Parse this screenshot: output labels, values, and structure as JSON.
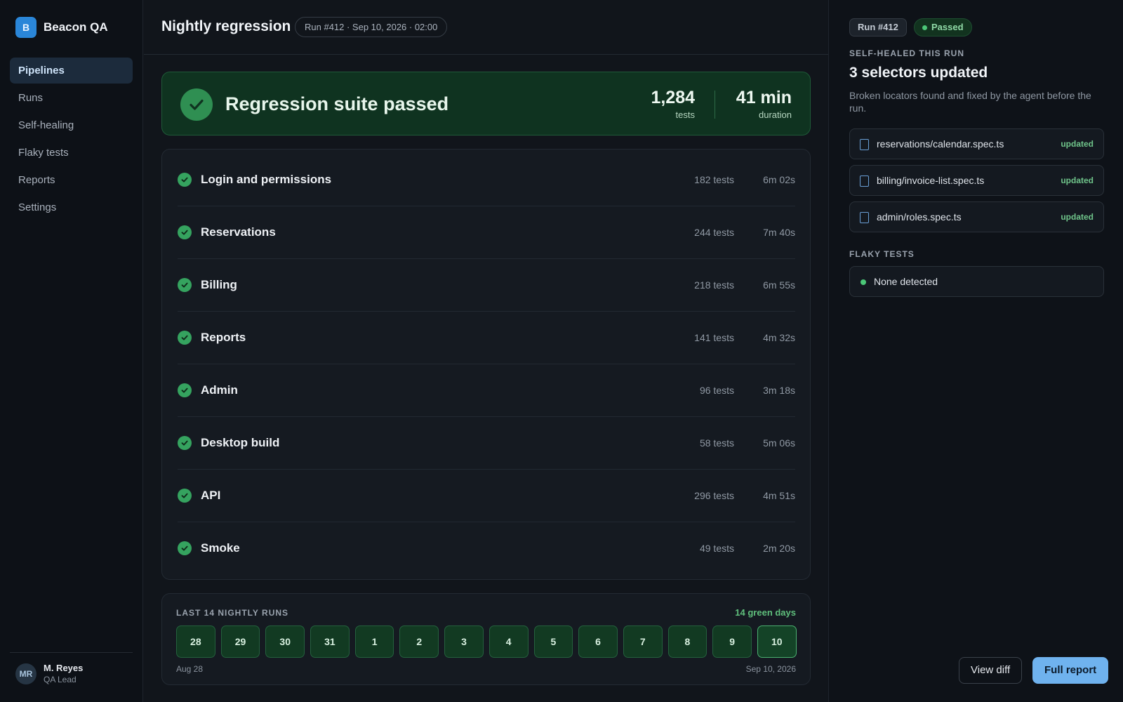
{
  "brand": {
    "logo_letter": "B",
    "name": "Beacon QA"
  },
  "sidebar": {
    "items": [
      {
        "label": "Pipelines",
        "active": true
      },
      {
        "label": "Runs",
        "active": false
      },
      {
        "label": "Self-healing",
        "active": false
      },
      {
        "label": "Flaky tests",
        "active": false
      },
      {
        "label": "Reports",
        "active": false
      },
      {
        "label": "Settings",
        "active": false
      }
    ]
  },
  "user": {
    "initials": "MR",
    "name": "M. Reyes",
    "role": "QA Lead"
  },
  "header": {
    "title": "Nightly regression",
    "run_chip": "Run #412 · Sep 10, 2026 · 02:00"
  },
  "banner": {
    "title": "Regression suite passed",
    "tests_value": "1,284",
    "tests_label": "tests",
    "duration_value": "41 min",
    "duration_label": "duration"
  },
  "suites": [
    {
      "name": "Login and permissions",
      "tests": "182 tests",
      "duration": "6m 02s"
    },
    {
      "name": "Reservations",
      "tests": "244 tests",
      "duration": "7m 40s"
    },
    {
      "name": "Billing",
      "tests": "218 tests",
      "duration": "6m 55s"
    },
    {
      "name": "Reports",
      "tests": "141 tests",
      "duration": "4m 32s"
    },
    {
      "name": "Admin",
      "tests": "96 tests",
      "duration": "3m 18s"
    },
    {
      "name": "Desktop build",
      "tests": "58 tests",
      "duration": "5m 06s"
    },
    {
      "name": "API",
      "tests": "296 tests",
      "duration": "4m 51s"
    },
    {
      "name": "Smoke",
      "tests": "49 tests",
      "duration": "2m 20s"
    }
  ],
  "history": {
    "title": "LAST 14 NIGHTLY RUNS",
    "green_days": "14 green days",
    "days": [
      "28",
      "29",
      "30",
      "31",
      "1",
      "2",
      "3",
      "4",
      "5",
      "6",
      "7",
      "8",
      "9",
      "10"
    ],
    "start_label": "Aug 28",
    "end_label": "Sep 10, 2026"
  },
  "panel": {
    "run_badge": "Run #412",
    "status_badge": "Passed",
    "self_heal_label": "SELF-HEALED THIS RUN",
    "self_heal_title": "3 selectors updated",
    "self_heal_desc": "Broken locators found and fixed by the agent before the run.",
    "files": [
      {
        "name": "reservations/calendar.spec.ts",
        "status": "updated"
      },
      {
        "name": "billing/invoice-list.spec.ts",
        "status": "updated"
      },
      {
        "name": "admin/roles.spec.ts",
        "status": "updated"
      }
    ],
    "flaky_label": "FLAKY TESTS",
    "flaky_value": "None detected",
    "view_diff": "View diff",
    "full_report": "Full report"
  },
  "colors": {
    "accent": "#2a86d8",
    "success": "#35a35f",
    "banner_bg": "#0f3320",
    "primary_button": "#6fb2ee"
  }
}
